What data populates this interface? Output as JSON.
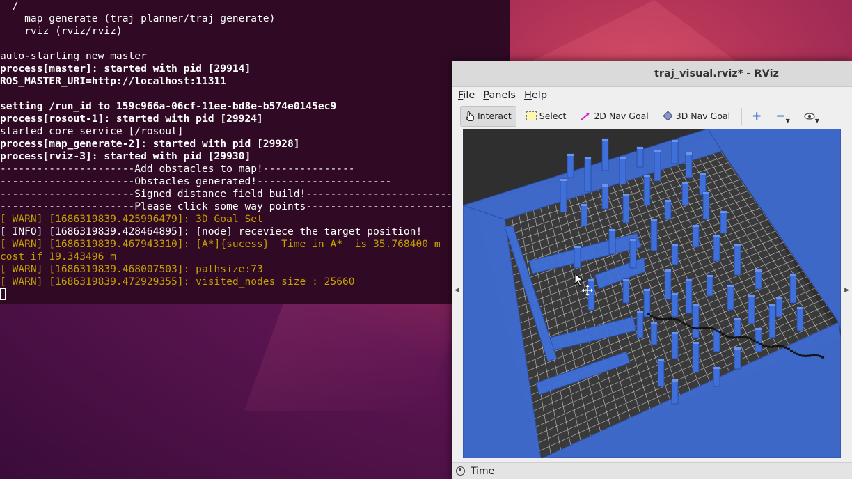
{
  "terminal": {
    "lines": [
      {
        "text": "  /",
        "style": "normal"
      },
      {
        "text": "    map_generate (traj_planner/traj_generate)",
        "style": "normal"
      },
      {
        "text": "    rviz (rviz/rviz)",
        "style": "normal"
      },
      {
        "text": "",
        "style": "normal"
      },
      {
        "text": "auto-starting new master",
        "style": "normal"
      },
      {
        "text": "process[master]: started with pid [29914]",
        "style": "bold"
      },
      {
        "text": "ROS_MASTER_URI=http://localhost:11311",
        "style": "bold"
      },
      {
        "text": "",
        "style": "normal"
      },
      {
        "text": "setting /run_id to 159c966a-06cf-11ee-bd8e-b574e0145ec9",
        "style": "bold"
      },
      {
        "text": "process[rosout-1]: started with pid [29924]",
        "style": "bold"
      },
      {
        "text": "started core service [/rosout]",
        "style": "normal"
      },
      {
        "text": "process[map_generate-2]: started with pid [29928]",
        "style": "bold"
      },
      {
        "text": "process[rviz-3]: started with pid [29930]",
        "style": "bold"
      },
      {
        "text": "----------------------Add obstacles to map!---------------",
        "style": "normal"
      },
      {
        "text": "----------------------Obstacles generated!----------------------",
        "style": "normal"
      },
      {
        "text": "----------------------Signed distance field build!------------------------",
        "style": "normal"
      },
      {
        "text": "----------------------Please click some way_points------------------------",
        "style": "normal"
      },
      {
        "text": "[ WARN] [1686319839.425996479]: 3D Goal Set",
        "style": "warn"
      },
      {
        "text": "[ INFO] [1686319839.428464895]: [node] receviece the target position!",
        "style": "normal"
      },
      {
        "text": "[ WARN] [1686319839.467943310]: [A*]{sucess}  Time in A*  is 35.768400 m",
        "style": "warn"
      },
      {
        "text": "cost if 19.343496 m",
        "style": "warn"
      },
      {
        "text": "[ WARN] [1686319839.468007503]: pathsize:73",
        "style": "warn"
      },
      {
        "text": "[ WARN] [1686319839.472929355]: visited_nodes size : 25660",
        "style": "warn"
      }
    ]
  },
  "rviz": {
    "title": "traj_visual.rviz* - RViz",
    "menu": {
      "file_ul": "F",
      "file_rest": "ile",
      "panels_ul": "P",
      "panels_rest": "anels",
      "help_ul": "H",
      "help_rest": "elp"
    },
    "toolbar": {
      "interact": "Interact",
      "select": "Select",
      "nav2d": "2D Nav Goal",
      "nav3d": "3D Nav Goal"
    },
    "status": {
      "time_label": "Time"
    }
  },
  "colors": {
    "terminal_bg": "#300a24",
    "warn": "#c4a000",
    "obstacle_blue": "#3f6fd8",
    "grid": "#d8d8d8",
    "viewport_bg": "#2f2f2f",
    "path": "#111111"
  }
}
